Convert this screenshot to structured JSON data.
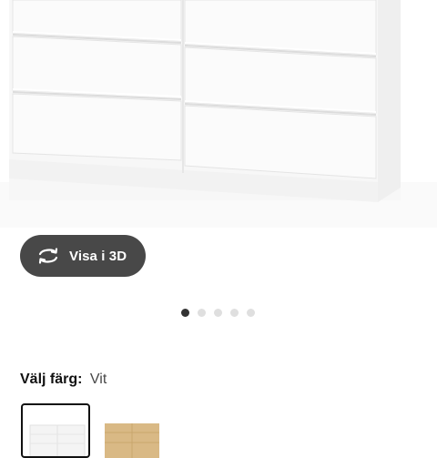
{
  "view3d": {
    "label": "Visa i 3D",
    "icon": "rotate-3d-icon"
  },
  "carousel": {
    "total": 5,
    "active_index": 0
  },
  "color_selector": {
    "label": "Välj färg:",
    "selected_value": "Vit",
    "swatches": [
      {
        "name": "white",
        "selected": true,
        "color": "#f5f5f5"
      },
      {
        "name": "oak",
        "selected": false,
        "color": "#d9b985"
      }
    ]
  },
  "colors": {
    "button_bg": "#484848",
    "button_text": "#ffffff",
    "dot_active": "#333333",
    "dot_inactive": "#dfdfdf",
    "furniture_white": "#f7f7f7",
    "oak": "#d9b985"
  }
}
